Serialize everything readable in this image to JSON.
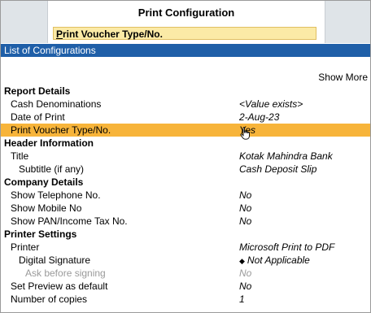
{
  "window": {
    "title": "Print Configuration"
  },
  "field": {
    "value_prefix": "P",
    "value_rest": "rint Voucher Type/No."
  },
  "list_header": "List of Configurations",
  "show_more": "Show More",
  "rows": {
    "report_details": "Report Details",
    "cash_denominations": {
      "label": "Cash Denominations",
      "value": "<Value exists>"
    },
    "date_of_print": {
      "label": "Date of Print",
      "value": "2-Aug-23"
    },
    "print_voucher": {
      "label": "Print Voucher Type/No.",
      "value": "Yes"
    },
    "header_information": "Header Information",
    "title": {
      "label": "Title",
      "value": "Kotak Mahindra Bank"
    },
    "subtitle": {
      "label": "Subtitle (if any)",
      "value": "Cash Deposit Slip"
    },
    "company_details": "Company Details",
    "telephone": {
      "label": "Show Telephone No.",
      "value": "No"
    },
    "mobile": {
      "label": "Show Mobile No",
      "value": "No"
    },
    "pan": {
      "label": "Show PAN/Income Tax No.",
      "value": "No"
    },
    "printer_settings": "Printer Settings",
    "printer": {
      "label": "Printer",
      "value": "Microsoft Print to PDF"
    },
    "digital_signature": {
      "label": "Digital Signature",
      "value": "Not Applicable"
    },
    "ask_before_signing": {
      "label": "Ask before signing",
      "value": "No"
    },
    "preview_default": {
      "label": "Set Preview as default",
      "value": "No"
    },
    "copies": {
      "label": "Number of copies",
      "value": "1"
    }
  },
  "colors": {
    "header_bg": "#1f5fa8",
    "highlight": "#f7b43a",
    "field_bg": "#fbeaa6"
  },
  "icons": {
    "cursor": "hand-pointer-icon",
    "bullet": "diamond-icon"
  }
}
